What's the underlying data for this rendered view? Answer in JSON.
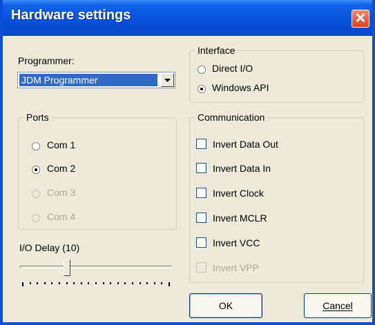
{
  "window": {
    "title": "Hardware settings",
    "close_symbol": "✕"
  },
  "programmer": {
    "label": "Programmer:",
    "selected": "JDM Programmer"
  },
  "interface": {
    "title": "Interface",
    "options": [
      {
        "label": "Direct I/O",
        "checked": false,
        "enabled": true
      },
      {
        "label": "Windows API",
        "checked": true,
        "enabled": true
      }
    ]
  },
  "ports": {
    "title": "Ports",
    "options": [
      {
        "label": "Com 1",
        "checked": false,
        "enabled": true
      },
      {
        "label": "Com 2",
        "checked": true,
        "enabled": true
      },
      {
        "label": "Com 3",
        "checked": false,
        "enabled": false
      },
      {
        "label": "Com 4",
        "checked": false,
        "enabled": false
      }
    ]
  },
  "communication": {
    "title": "Communication",
    "options": [
      {
        "label": "Invert Data Out",
        "checked": false,
        "enabled": true
      },
      {
        "label": "Invert Data In",
        "checked": false,
        "enabled": true
      },
      {
        "label": "Invert Clock",
        "checked": false,
        "enabled": true
      },
      {
        "label": "Invert MCLR",
        "checked": false,
        "enabled": true
      },
      {
        "label": "Invert VCC",
        "checked": false,
        "enabled": true
      },
      {
        "label": "Invert VPP",
        "checked": false,
        "enabled": false
      }
    ]
  },
  "io_delay": {
    "label": "I/O Delay (10)",
    "value": 10
  },
  "buttons": {
    "ok": "OK",
    "cancel": "Cancel"
  },
  "colors": {
    "titlebar": "#0a50d9",
    "selection": "#316ac5",
    "disabled_text": "#aca899"
  }
}
